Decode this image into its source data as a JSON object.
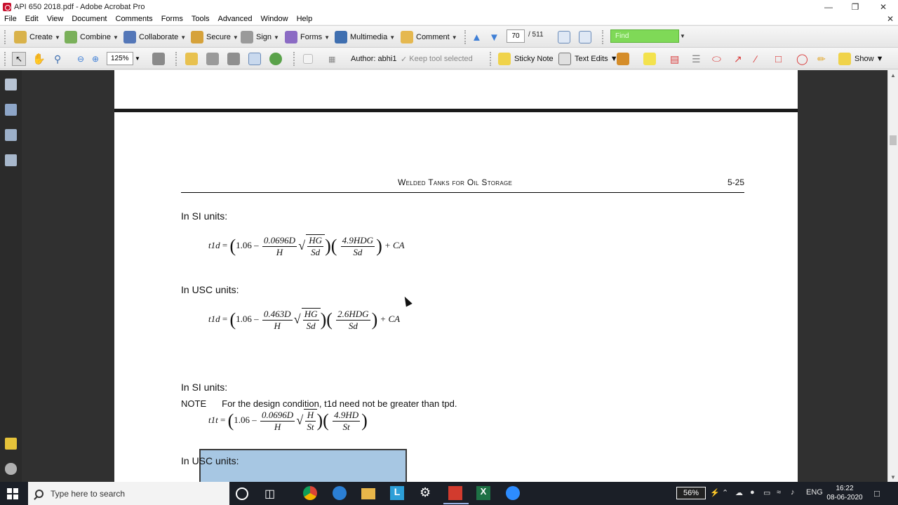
{
  "window": {
    "title": "API 650  2018.pdf - Adobe Acrobat Pro"
  },
  "menu": [
    "File",
    "Edit",
    "View",
    "Document",
    "Comments",
    "Forms",
    "Tools",
    "Advanced",
    "Window",
    "Help"
  ],
  "toolbar1": {
    "create": "Create",
    "combine": "Combine",
    "collaborate": "Collaborate",
    "secure": "Secure",
    "sign": "Sign",
    "forms": "Forms",
    "multimedia": "Multimedia",
    "comment": "Comment",
    "page_current": "70",
    "page_total": "/ 511",
    "find_placeholder": "Find"
  },
  "toolbar2": {
    "zoom": "125%",
    "author": "Author: abhi1",
    "keep_tool": "Keep tool selected",
    "sticky_note": "Sticky Note",
    "text_edits": "Text Edits",
    "show": "Show"
  },
  "page": {
    "running_title": "Welded Tanks for Oil Storage",
    "page_number": "5-25",
    "si_units_1": "In SI units:",
    "usc_units_1": "In USC units:",
    "si_units_2": "In SI units:",
    "usc_units_2": "In USC units:",
    "note_label": "NOTE",
    "note_text": "For the design condition, t1d need not be greater than tpd.",
    "eq1": {
      "lhs": "t1d",
      "a": "1.06",
      "num1": "0.0696D",
      "den1": "H",
      "root_num": "HG",
      "root_den": "Sd",
      "num2": "4.9HDG",
      "den2": "Sd",
      "tail": "+ CA"
    },
    "eq2": {
      "lhs": "t1d",
      "a": "1.06",
      "num1": "0.463D",
      "den1": "H",
      "root_num": "HG",
      "root_den": "Sd",
      "num2": "2.6HDG",
      "den2": "Sd",
      "tail": "+ CA"
    },
    "eq3": {
      "lhs": "t1t",
      "a": "1.06",
      "num1": "0.0696D",
      "den1": "H",
      "root_num": "H",
      "root_den": "St",
      "num2": "4.9HD",
      "den2": "St"
    }
  },
  "taskbar": {
    "search_placeholder": "Type here to search",
    "battery": "56%",
    "language": "ENG",
    "time": "16:22",
    "date": "08-06-2020"
  }
}
